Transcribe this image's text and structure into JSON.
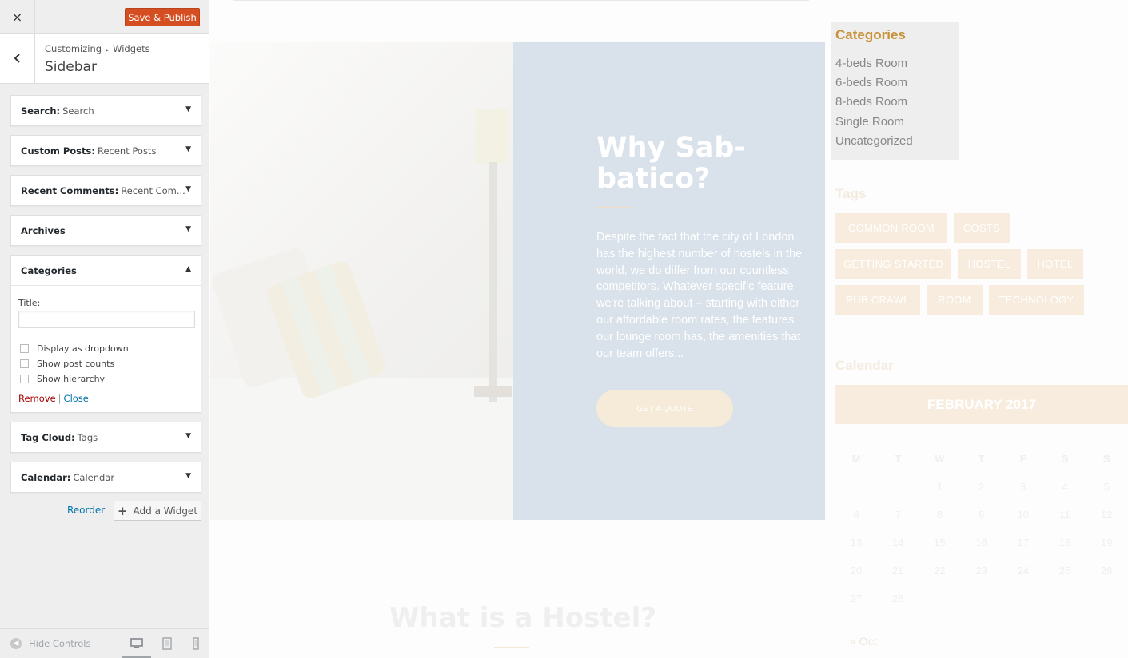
{
  "panel": {
    "close_glyph": "×",
    "publish_label": "Save & Publish",
    "breadcrumb": {
      "root": "Customizing",
      "separator": "▸",
      "current": "Widgets"
    },
    "section_title": "Sidebar",
    "widgets": [
      {
        "name": "Search:",
        "title": "Search"
      },
      {
        "name": "Custom Posts:",
        "title": "Recent Posts"
      },
      {
        "name": "Recent Comments:",
        "title": "Recent Com..."
      },
      {
        "name": "Archives",
        "title": ""
      },
      {
        "name": "Categories",
        "title": ""
      },
      {
        "name": "Tag Cloud:",
        "title": "Tags"
      },
      {
        "name": "Calendar:",
        "title": "Calendar"
      }
    ],
    "categories_form": {
      "title_label": "Title:",
      "title_value": "",
      "options": [
        "Display as dropdown",
        "Show post counts",
        "Show hierarchy"
      ],
      "remove_label": "Remove",
      "pipe": "|",
      "close_label": "Close"
    },
    "reorder_label": "Reorder",
    "add_widget_label": "Add a Widget",
    "hide_controls_label": "Hide Controls"
  },
  "preview": {
    "hero": {
      "title": "Why Sab-batico?",
      "text": "Despite the fact that the city of London has the highest number of hostels in the world, we do differ from our countless competitors. Whatever specific feature we're talking about – starting with either our affordable room rates, the features our lounge room has, the amenities that our team offers...",
      "button_label": "GET A QUOTE"
    },
    "section_heading": "What is a Hostel?",
    "categories": {
      "heading": "Categories",
      "items": [
        "4-beds Room",
        "6-beds Room",
        "8-beds Room",
        "Single Room",
        "Uncategorized"
      ]
    },
    "tags": {
      "heading": "Tags",
      "items": [
        "COMMON ROOM",
        "COSTS",
        "GETTING STARTED",
        "HOSTEL",
        "HOTEL",
        "PUB CRAWL",
        "ROOM",
        "TECHNOLOGY"
      ]
    },
    "calendar": {
      "heading": "Calendar",
      "month": "FEBRUARY 2017",
      "weekdays": [
        "M",
        "T",
        "W",
        "T",
        "F",
        "S",
        "S"
      ],
      "weeks": [
        [
          "",
          "",
          "1",
          "2",
          "3",
          "4",
          "5"
        ],
        [
          "6",
          "7",
          "8",
          "9",
          "10",
          "11",
          "12"
        ],
        [
          "13",
          "14",
          "15",
          "16",
          "17",
          "18",
          "19"
        ],
        [
          "20",
          "21",
          "22",
          "23",
          "24",
          "25",
          "26"
        ],
        [
          "27",
          "28",
          "",
          "",
          "",
          "",
          ""
        ]
      ],
      "prev_label": "« Oct"
    }
  },
  "colors": {
    "publish": "#d54e21",
    "link": "#0073aa",
    "remove": "#aa0000",
    "categories_heading": "#c8913a",
    "hero_box": "#d9e1ea"
  },
  "icons": {
    "close": "close-icon",
    "back": "chevron-left-icon",
    "collapse": "triangle-down-icon",
    "expand": "triangle-up-icon",
    "add": "plus-icon",
    "hide_controls": "collapse-circle-icon",
    "desktop": "desktop-icon",
    "tablet": "tablet-icon",
    "mobile": "mobile-icon"
  }
}
